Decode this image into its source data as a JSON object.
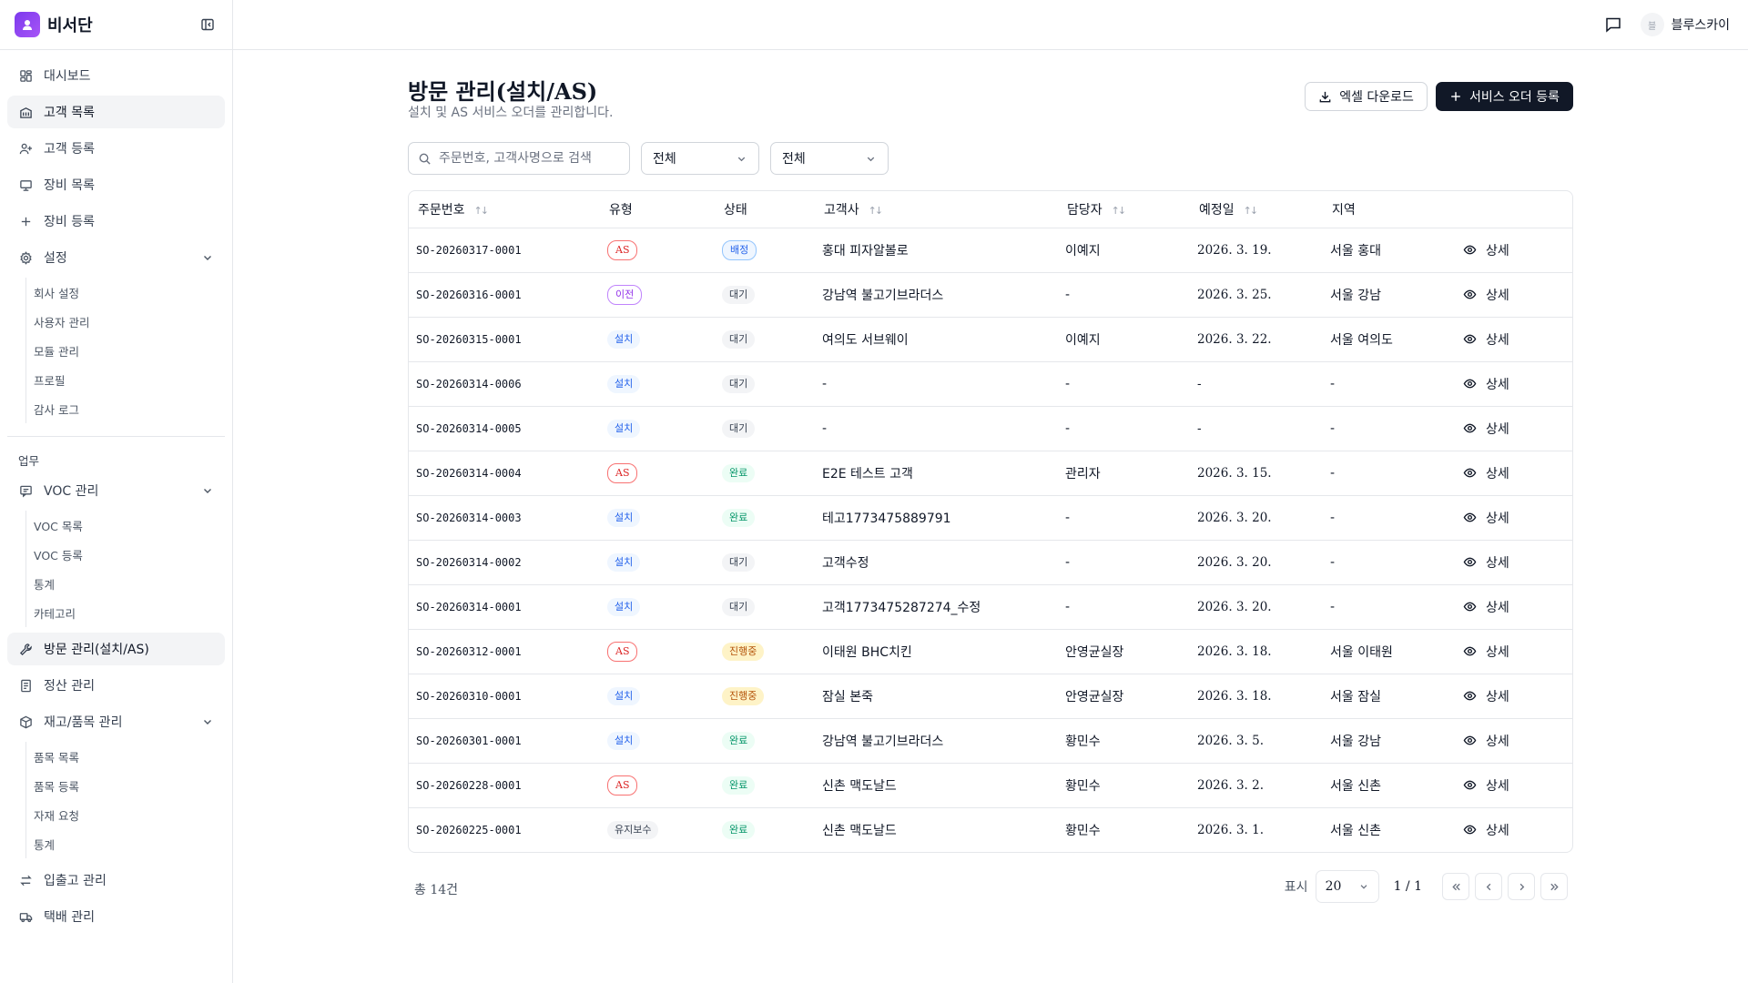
{
  "brand": {
    "name": "비서단"
  },
  "sidebar": {
    "items_top": [
      {
        "label": "대시보드",
        "icon": "dashboard-icon"
      },
      {
        "label": "고객 목록",
        "icon": "building-icon",
        "active": true
      },
      {
        "label": "고객 등록",
        "icon": "user-plus-icon"
      },
      {
        "label": "장비 목록",
        "icon": "monitor-icon"
      },
      {
        "label": "장비 등록",
        "icon": "plus-icon"
      },
      {
        "label": "설정",
        "icon": "gear-icon"
      }
    ],
    "settings_sub": [
      "회사 설정",
      "사용자 관리",
      "모듈 관리",
      "프로필",
      "감사 로그"
    ],
    "section_label": "업무",
    "voc": {
      "label": "VOC 관리"
    },
    "voc_sub": [
      "VOC 목록",
      "VOC 등록",
      "통계",
      "카테고리"
    ],
    "visit": {
      "label": "방문 관리(설치/AS)"
    },
    "settle": {
      "label": "정산 관리"
    },
    "stock": {
      "label": "재고/품목 관리"
    },
    "stock_sub": [
      "품목 목록",
      "품목 등록",
      "자재 요청",
      "통계"
    ],
    "io": {
      "label": "입출고 관리"
    },
    "delivery": {
      "label": "택배 관리"
    }
  },
  "topbar": {
    "avatar_initial": "블",
    "user_name": "블루스카이"
  },
  "page": {
    "title": "방문 관리(설치/AS)",
    "subtitle": "설치 및 AS 서비스 오더를 관리합니다.",
    "excel_label": "엑셀 다운로드",
    "register_label": "서비스 오더 등록"
  },
  "filters": {
    "search_placeholder": "주문번호, 고객사명으로 검색",
    "type_value": "전체",
    "status_value": "전체"
  },
  "table": {
    "columns": [
      "주문번호",
      "유형",
      "상태",
      "고객사",
      "담당자",
      "예정일",
      "지역"
    ],
    "detail_label": "상세",
    "rows": [
      [
        "SO-20260317-0001",
        "AS",
        "배정",
        "홍대 피자알볼로",
        "이예지",
        "2026. 3. 19.",
        "서울 홍대"
      ],
      [
        "SO-20260316-0001",
        "이전",
        "대기",
        "강남역 불고기브라더스",
        "-",
        "2026. 3. 25.",
        "서울 강남"
      ],
      [
        "SO-20260315-0001",
        "설치",
        "대기",
        "여의도 서브웨이",
        "이예지",
        "2026. 3. 22.",
        "서울 여의도"
      ],
      [
        "SO-20260314-0006",
        "설치",
        "대기",
        "-",
        "-",
        "-",
        "-"
      ],
      [
        "SO-20260314-0005",
        "설치",
        "대기",
        "-",
        "-",
        "-",
        "-"
      ],
      [
        "SO-20260314-0004",
        "AS",
        "완료",
        "E2E 테스트 고객",
        "관리자",
        "2026. 3. 15.",
        "-"
      ],
      [
        "SO-20260314-0003",
        "설치",
        "완료",
        "테고1773475889791",
        "-",
        "2026. 3. 20.",
        "-"
      ],
      [
        "SO-20260314-0002",
        "설치",
        "대기",
        "고객수정",
        "-",
        "2026. 3. 20.",
        "-"
      ],
      [
        "SO-20260314-0001",
        "설치",
        "대기",
        "고객1773475287274_수정",
        "-",
        "2026. 3. 20.",
        "-"
      ],
      [
        "SO-20260312-0001",
        "AS",
        "진행중",
        "이태원 BHC치킨",
        "안영균실장",
        "2026. 3. 18.",
        "서울 이태원"
      ],
      [
        "SO-20260310-0001",
        "설치",
        "진행중",
        "잠실 본죽",
        "안영균실장",
        "2026. 3. 18.",
        "서울 잠실"
      ],
      [
        "SO-20260301-0001",
        "설치",
        "완료",
        "강남역 불고기브라더스",
        "황민수",
        "2026. 3. 5.",
        "서울 강남"
      ],
      [
        "SO-20260228-0001",
        "AS",
        "완료",
        "신촌 맥도날드",
        "황민수",
        "2026. 3. 2.",
        "서울 신촌"
      ],
      [
        "SO-20260225-0001",
        "유지보수",
        "완료",
        "신촌 맥도날드",
        "황민수",
        "2026. 3. 1.",
        "서울 신촌"
      ]
    ]
  },
  "footer": {
    "total": "총 14건",
    "page_size_label": "표시",
    "page_size": "20",
    "page_info": "1 / 1"
  }
}
